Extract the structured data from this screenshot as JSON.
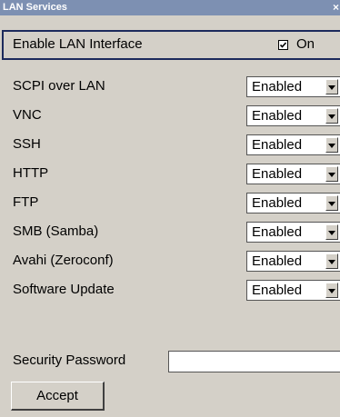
{
  "window": {
    "title": "LAN Services",
    "close_glyph": "×"
  },
  "enable_lan": {
    "label": "Enable LAN Interface",
    "checked": true,
    "state_label": "On"
  },
  "services": [
    {
      "label": "SCPI over LAN",
      "value": "Enabled"
    },
    {
      "label": "VNC",
      "value": "Enabled"
    },
    {
      "label": "SSH",
      "value": "Enabled"
    },
    {
      "label": "HTTP",
      "value": "Enabled"
    },
    {
      "label": "FTP",
      "value": "Enabled"
    },
    {
      "label": "SMB (Samba)",
      "value": "Enabled"
    },
    {
      "label": "Avahi (Zeroconf)",
      "value": "Enabled"
    },
    {
      "label": "Software Update",
      "value": "Enabled"
    }
  ],
  "security": {
    "label": "Security Password",
    "value": ""
  },
  "accept_label": "Accept",
  "colors": {
    "title_bar": "#7d90b2",
    "background": "#d4d0c8",
    "focus_border": "#1c2a5c"
  }
}
